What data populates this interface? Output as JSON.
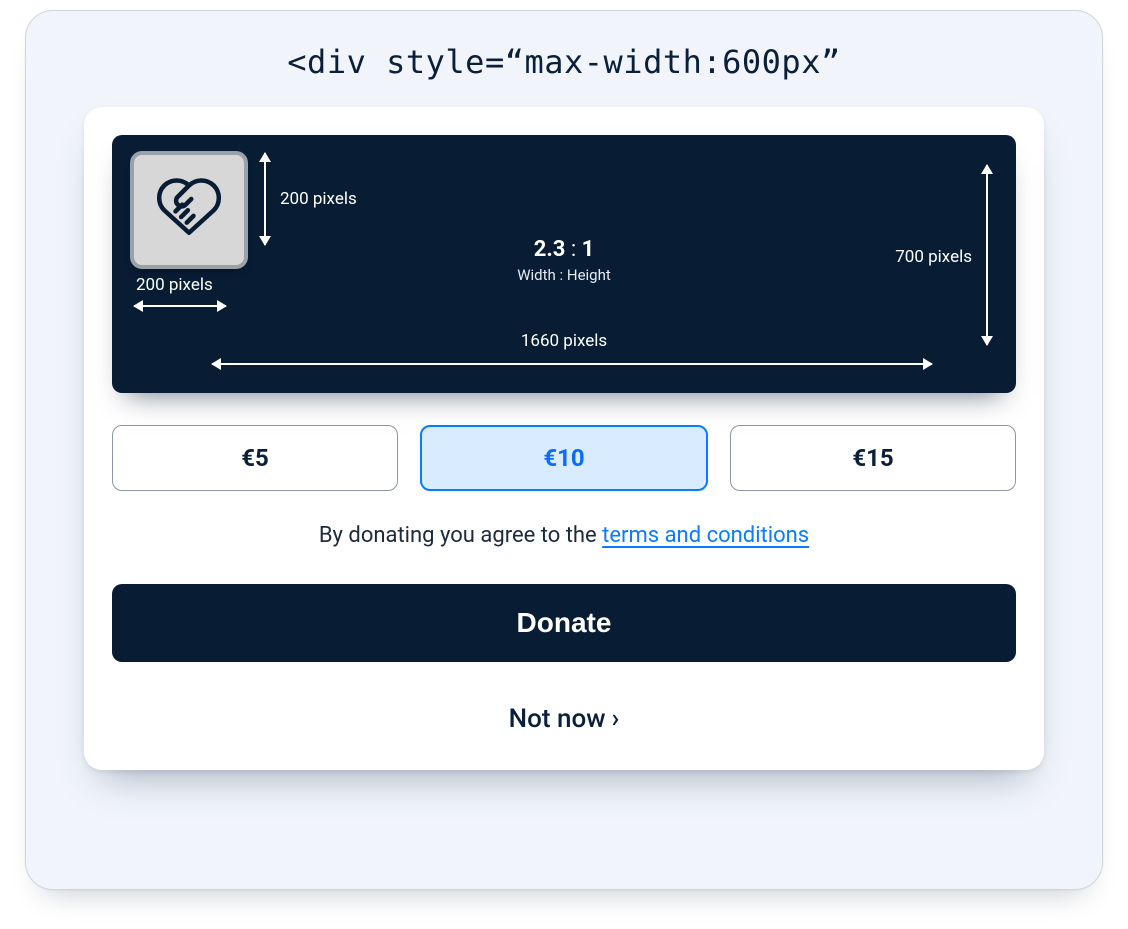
{
  "caption": "<div style=“max-width:600px”",
  "banner": {
    "logo_icon": "handshake-heart-icon",
    "logo_dim_h_label": "200 pixels",
    "logo_dim_v_label": "200 pixels",
    "full_height_label": "700 pixels",
    "full_width_label": "1660 pixels",
    "ratio_w": "2.3",
    "ratio_sep": ":",
    "ratio_h": "1",
    "ratio_caption": "Width : Height"
  },
  "amounts": {
    "opt1": "€5",
    "opt2": "€10",
    "opt3": "€15"
  },
  "terms": {
    "prefix": "By donating you agree to the ",
    "link": "terms and conditions"
  },
  "actions": {
    "donate": "Donate",
    "not_now": "Not now",
    "chevron": "›"
  }
}
